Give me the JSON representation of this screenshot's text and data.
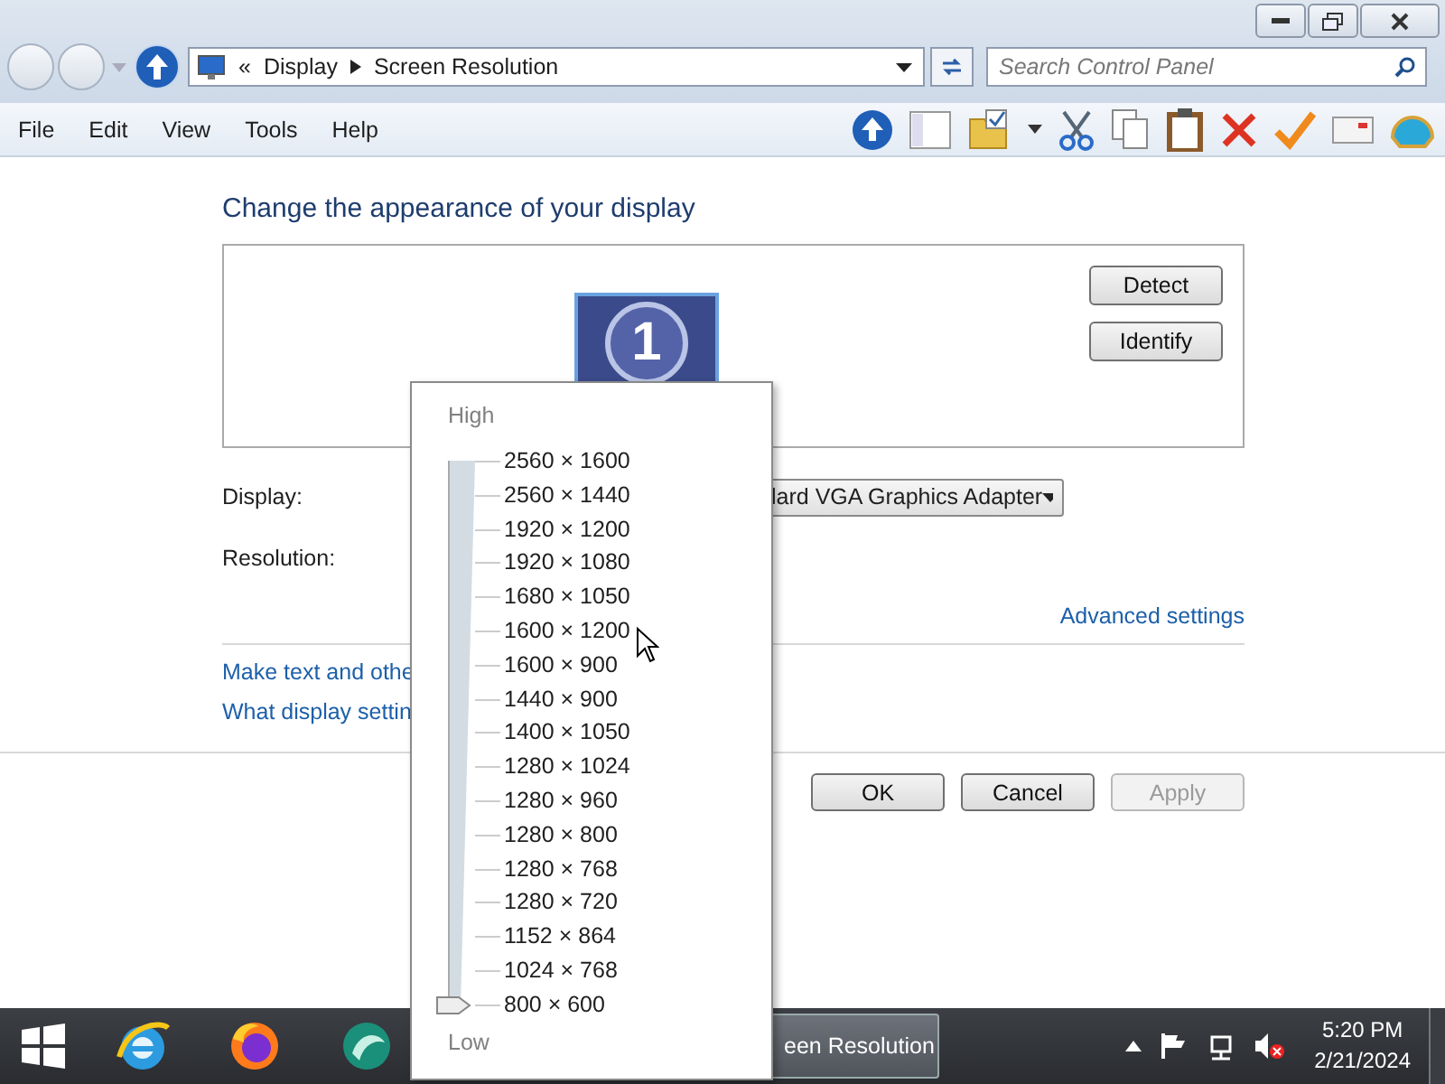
{
  "address_bar": {
    "chevron": "«",
    "crumbs": [
      "Display",
      "Screen Resolution"
    ]
  },
  "search": {
    "placeholder": "Search Control Panel"
  },
  "menu": [
    "File",
    "Edit",
    "View",
    "Tools",
    "Help"
  ],
  "heading": "Change the appearance of your display",
  "monitor": {
    "number": "1"
  },
  "side_buttons": [
    "Detect",
    "Identify"
  ],
  "display": {
    "label": "Display:",
    "value": "lard VGA Graphics Adapter"
  },
  "resolution": {
    "label": "Resolution:"
  },
  "advanced_link": "Advanced settings",
  "links": [
    "Make text and othe",
    "What display settin"
  ],
  "dialog_buttons": [
    {
      "label": "OK",
      "disabled": false
    },
    {
      "label": "Cancel",
      "disabled": false
    },
    {
      "label": "Apply",
      "disabled": true
    }
  ],
  "resolution_popup": {
    "high_label": "High",
    "low_label": "Low",
    "level": 0,
    "options": [
      "2560 × 1600",
      "2560 × 1440",
      "1920 × 1200",
      "1920 × 1080",
      "1680 × 1050",
      "1600 × 1200",
      "1600 × 900",
      "1440 × 900",
      "1400 × 1050",
      "1280 × 1024",
      "1280 × 960",
      "1280 × 800",
      "1280 × 768",
      "1280 × 720",
      "1152 × 864",
      "1024 × 768",
      "800 × 600"
    ]
  },
  "taskbar": {
    "window_button": "een Resolution",
    "time": "5:20 PM",
    "date": "2/21/2024"
  }
}
